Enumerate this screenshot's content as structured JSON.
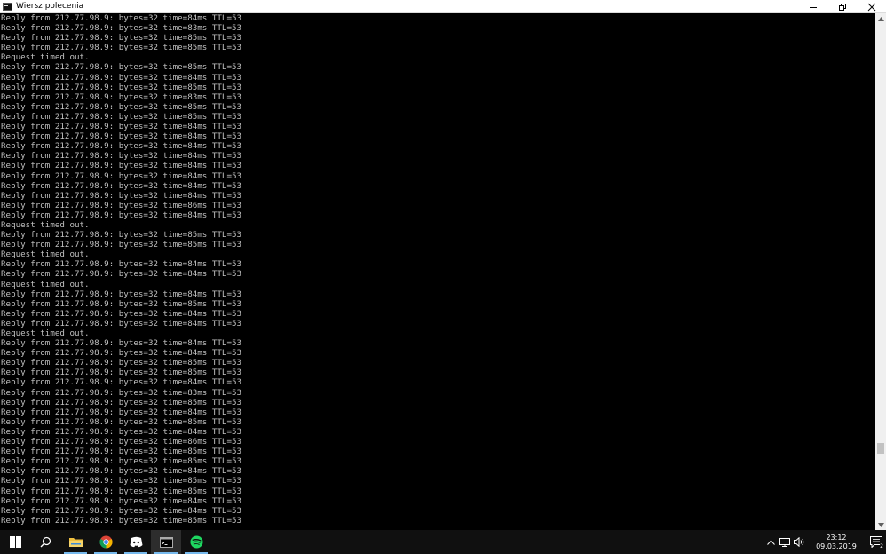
{
  "window": {
    "title": "Wiersz polecenia",
    "icon": "cmd-icon",
    "controls": [
      "minimize-icon",
      "restore-icon",
      "close-icon"
    ]
  },
  "console": {
    "lines": [
      "Reply from 212.77.98.9: bytes=32 time=84ms TTL=53",
      "Reply from 212.77.98.9: bytes=32 time=83ms TTL=53",
      "Reply from 212.77.98.9: bytes=32 time=85ms TTL=53",
      "Reply from 212.77.98.9: bytes=32 time=85ms TTL=53",
      "Request timed out.",
      "Reply from 212.77.98.9: bytes=32 time=85ms TTL=53",
      "Reply from 212.77.98.9: bytes=32 time=84ms TTL=53",
      "Reply from 212.77.98.9: bytes=32 time=85ms TTL=53",
      "Reply from 212.77.98.9: bytes=32 time=83ms TTL=53",
      "Reply from 212.77.98.9: bytes=32 time=85ms TTL=53",
      "Reply from 212.77.98.9: bytes=32 time=85ms TTL=53",
      "Reply from 212.77.98.9: bytes=32 time=84ms TTL=53",
      "Reply from 212.77.98.9: bytes=32 time=84ms TTL=53",
      "Reply from 212.77.98.9: bytes=32 time=84ms TTL=53",
      "Reply from 212.77.98.9: bytes=32 time=84ms TTL=53",
      "Reply from 212.77.98.9: bytes=32 time=84ms TTL=53",
      "Reply from 212.77.98.9: bytes=32 time=84ms TTL=53",
      "Reply from 212.77.98.9: bytes=32 time=84ms TTL=53",
      "Reply from 212.77.98.9: bytes=32 time=84ms TTL=53",
      "Reply from 212.77.98.9: bytes=32 time=86ms TTL=53",
      "Reply from 212.77.98.9: bytes=32 time=84ms TTL=53",
      "Request timed out.",
      "Reply from 212.77.98.9: bytes=32 time=85ms TTL=53",
      "Reply from 212.77.98.9: bytes=32 time=85ms TTL=53",
      "Request timed out.",
      "Reply from 212.77.98.9: bytes=32 time=84ms TTL=53",
      "Reply from 212.77.98.9: bytes=32 time=84ms TTL=53",
      "Request timed out.",
      "Reply from 212.77.98.9: bytes=32 time=84ms TTL=53",
      "Reply from 212.77.98.9: bytes=32 time=85ms TTL=53",
      "Reply from 212.77.98.9: bytes=32 time=84ms TTL=53",
      "Reply from 212.77.98.9: bytes=32 time=84ms TTL=53",
      "Request timed out.",
      "Reply from 212.77.98.9: bytes=32 time=84ms TTL=53",
      "Reply from 212.77.98.9: bytes=32 time=84ms TTL=53",
      "Reply from 212.77.98.9: bytes=32 time=85ms TTL=53",
      "Reply from 212.77.98.9: bytes=32 time=85ms TTL=53",
      "Reply from 212.77.98.9: bytes=32 time=84ms TTL=53",
      "Reply from 212.77.98.9: bytes=32 time=83ms TTL=53",
      "Reply from 212.77.98.9: bytes=32 time=85ms TTL=53",
      "Reply from 212.77.98.9: bytes=32 time=84ms TTL=53",
      "Reply from 212.77.98.9: bytes=32 time=85ms TTL=53",
      "Reply from 212.77.98.9: bytes=32 time=84ms TTL=53",
      "Reply from 212.77.98.9: bytes=32 time=86ms TTL=53",
      "Reply from 212.77.98.9: bytes=32 time=85ms TTL=53",
      "Reply from 212.77.98.9: bytes=32 time=85ms TTL=53",
      "Reply from 212.77.98.9: bytes=32 time=84ms TTL=53",
      "Reply from 212.77.98.9: bytes=32 time=85ms TTL=53",
      "Reply from 212.77.98.9: bytes=32 time=85ms TTL=53",
      "Reply from 212.77.98.9: bytes=32 time=84ms TTL=53",
      "Reply from 212.77.98.9: bytes=32 time=84ms TTL=53",
      "Reply from 212.77.98.9: bytes=32 time=85ms TTL=53"
    ],
    "colors": {
      "background": "#000000",
      "text": "#c0c0c0"
    }
  },
  "taskbar": {
    "apps": [
      {
        "name": "start-button",
        "icon": "windows-logo-icon"
      },
      {
        "name": "search-button",
        "icon": "search-icon"
      },
      {
        "name": "file-explorer-button",
        "icon": "folder-icon"
      },
      {
        "name": "chrome-button",
        "icon": "chrome-icon"
      },
      {
        "name": "discord-button",
        "icon": "discord-icon"
      },
      {
        "name": "command-prompt-button",
        "icon": "cmd-icon",
        "active": true
      },
      {
        "name": "spotify-button",
        "icon": "spotify-icon"
      }
    ],
    "tray": {
      "icons": [
        "chevron-up-icon",
        "network-icon",
        "volume-icon"
      ],
      "time": "23:12",
      "date": "09.03.2019",
      "notification_count": "2"
    },
    "colors": {
      "background": "#101010",
      "accent": "#76b9ed"
    }
  }
}
